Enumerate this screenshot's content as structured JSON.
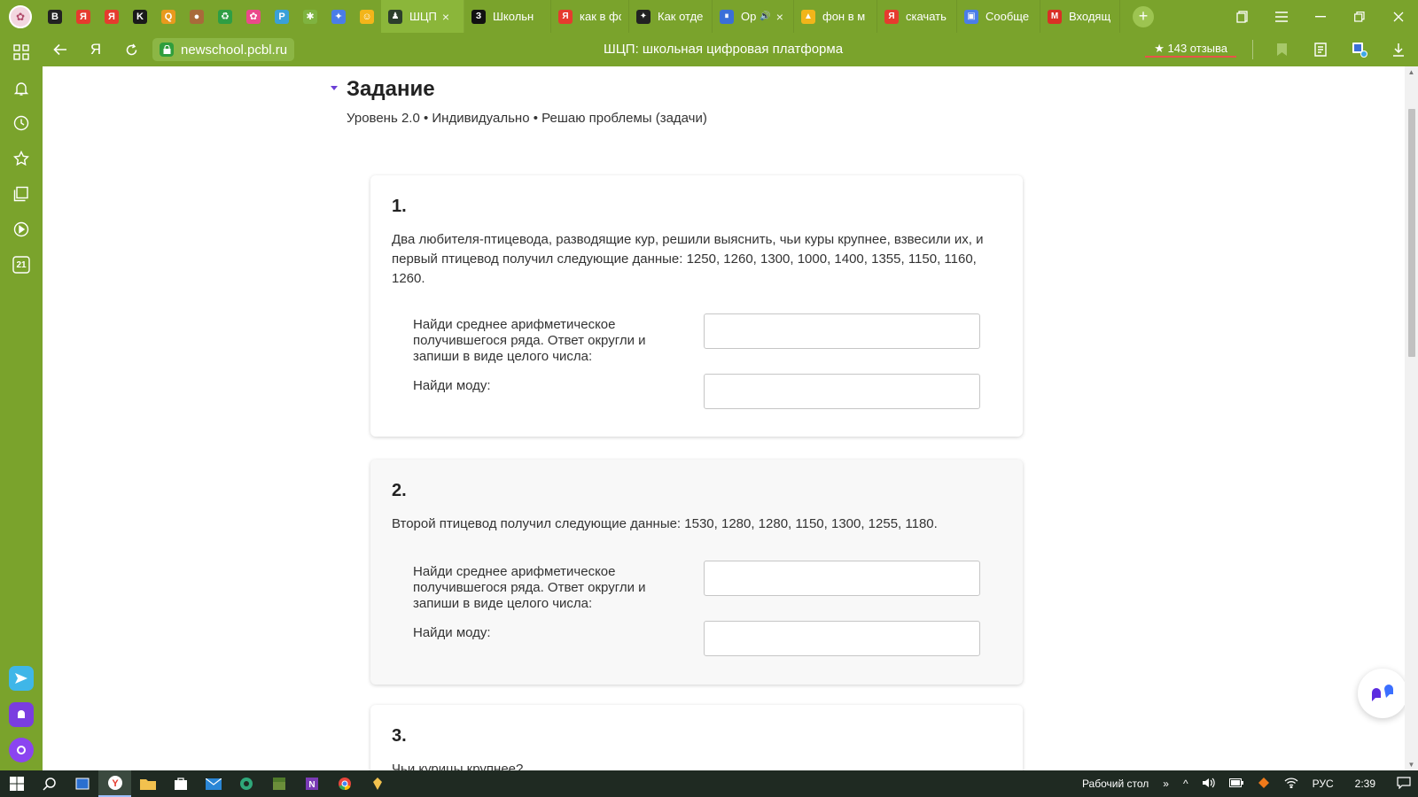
{
  "browser": {
    "profile_initial": "",
    "pinned_tabs": [
      {
        "icon": "B",
        "color": "#222222"
      },
      {
        "icon": "Я",
        "color": "#e53b2e"
      },
      {
        "icon": "Я",
        "color": "#e53b2e"
      },
      {
        "icon": "K",
        "color": "#1a1a1a"
      },
      {
        "icon": "Q",
        "color": "#e89a1d"
      },
      {
        "icon": "●",
        "color": "#a86a3a"
      },
      {
        "icon": "♻",
        "color": "#2e9e44"
      },
      {
        "icon": "✿",
        "color": "#ea4a8a"
      },
      {
        "icon": "P",
        "color": "#3aa0d8"
      },
      {
        "icon": "✱",
        "color": "#7fb340"
      },
      {
        "icon": "✦",
        "color": "#4a7de8"
      },
      {
        "icon": "☺",
        "color": "#f3b51a"
      }
    ],
    "tabs": [
      {
        "label": "ШЦП",
        "icon": "♟",
        "color": "#2c3e2c",
        "active": true,
        "close": "×"
      },
      {
        "label": "Школьн",
        "icon": "З",
        "color": "#111111",
        "active": false
      },
      {
        "label": "как в фо",
        "icon": "Я",
        "color": "#e53b2e",
        "active": false
      },
      {
        "label": "Как отде",
        "icon": "✦",
        "color": "#222222",
        "active": false
      },
      {
        "label": "Ор",
        "icon": "⏸",
        "color": "#3a6fd8",
        "active": false,
        "audio": "🔊",
        "close": "×"
      },
      {
        "label": "фон в м",
        "icon": "▲",
        "color": "#f2b51a",
        "active": false
      },
      {
        "label": "скачать",
        "icon": "Я",
        "color": "#e53b2e",
        "active": false
      },
      {
        "label": "Сообще",
        "icon": "▣",
        "color": "#4a7de8",
        "active": false
      },
      {
        "label": "Входящ",
        "icon": "M",
        "color": "#d93025",
        "active": false
      }
    ],
    "new_tab": "+",
    "url": "newschool.pcbl.ru",
    "title": "ШЦП: школьная цифровая платформа",
    "reviews": "★ 143 отзыва"
  },
  "sidebar": {
    "items": [
      "apps-icon",
      "bell-icon",
      "history-icon",
      "star-icon",
      "collections-icon",
      "play-icon",
      "calendar-icon"
    ],
    "calendar_label": "21"
  },
  "task": {
    "title": "Задание",
    "meta": "Уровень 2.0 • Индивидуально  • Решаю проблемы (задачи)"
  },
  "questions": [
    {
      "num": "1.",
      "text": "Два любителя-птицевода, разводящие кур, решили выяснить, чьи куры крупнее, взвесили их, и первый птицевод получил следующие данные: 1250, 1260, 1300, 1000, 1400, 1355, 1150, 1160, 1260.",
      "mean_label": "Найди среднее арифметическое получившегося ряда. Ответ округли и запиши в виде целого числа:",
      "mode_label": "Найди моду:",
      "mean_value": "",
      "mode_value": ""
    },
    {
      "num": "2.",
      "text": "Второй птицевод получил следующие данные: 1530, 1280, 1280, 1150, 1300, 1255, 1180.",
      "mean_label": "Найди среднее арифметическое получившегося ряда. Ответ округли и запиши в виде целого числа:",
      "mode_label": "Найди моду:",
      "mean_value": "",
      "mode_value": ""
    },
    {
      "num": "3.",
      "text": "Чьи курицы крупнее?"
    }
  ],
  "taskbar": {
    "desktop_label": "Рабочий стол",
    "lang": "РУС",
    "time": "2:39"
  }
}
